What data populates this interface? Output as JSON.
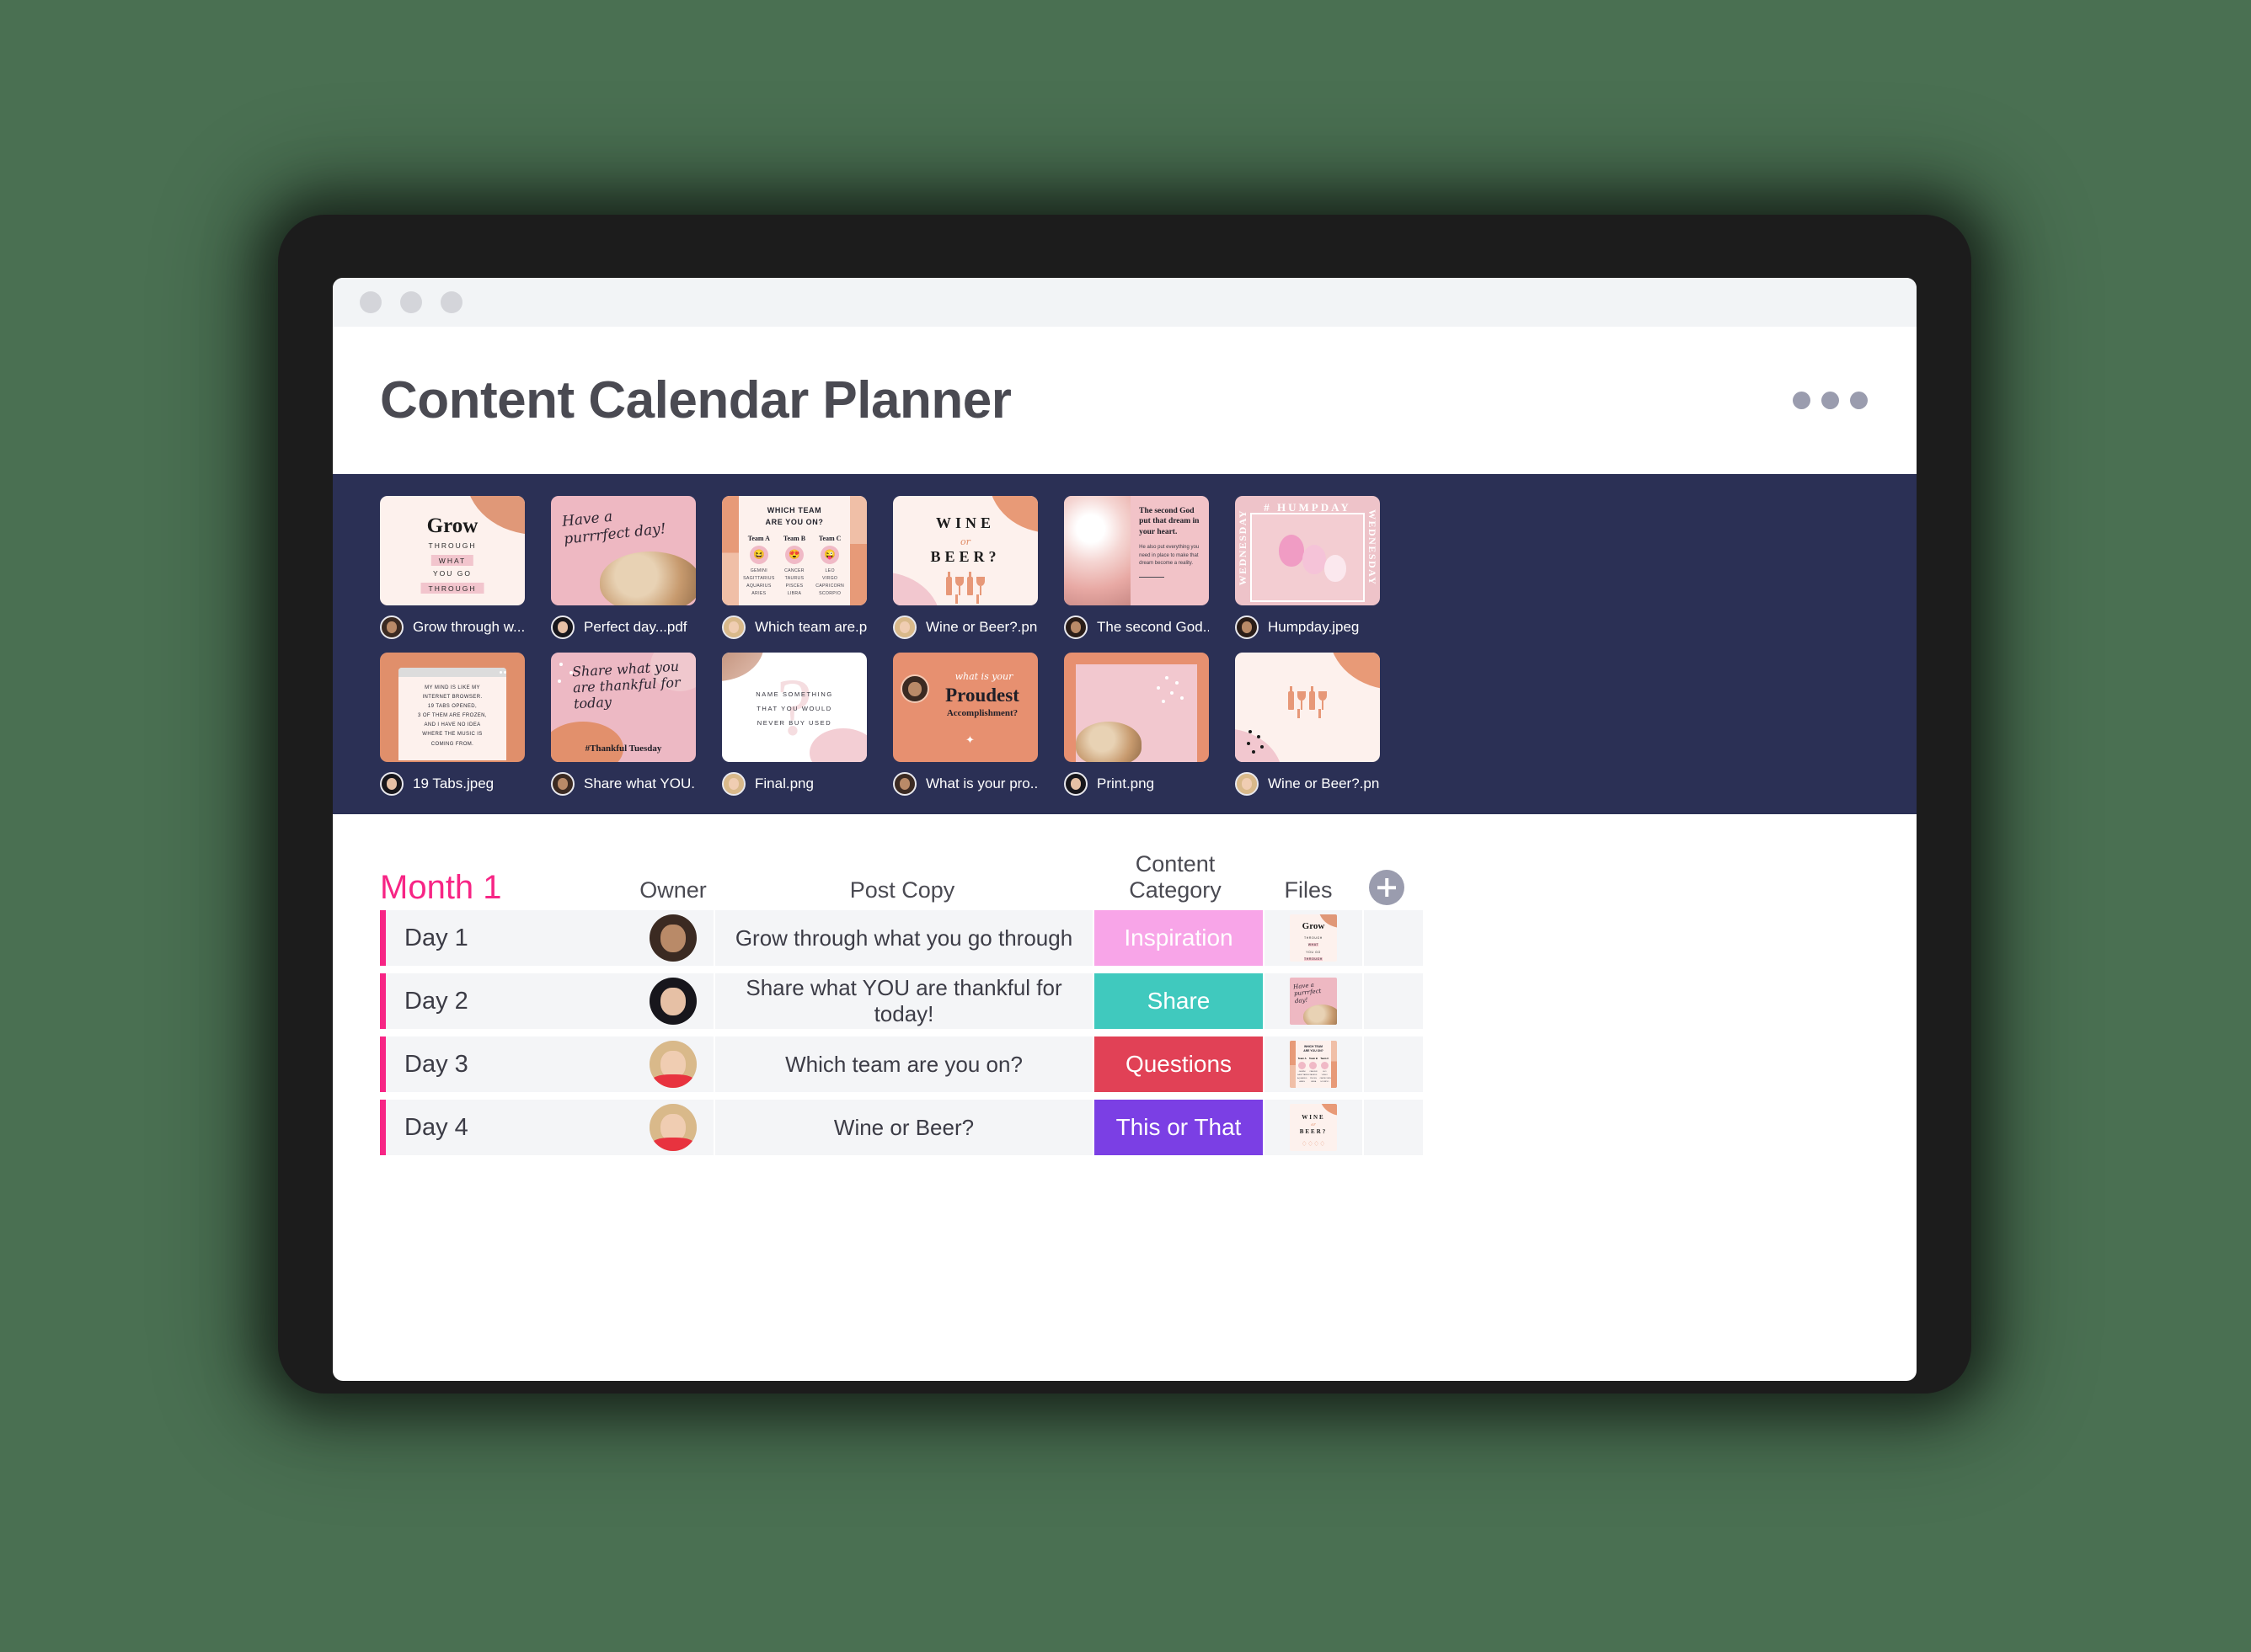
{
  "window": {
    "chrome_dots": 3,
    "title": "Content Calendar Planner",
    "more_menu_label": "more-options"
  },
  "theme": {
    "page_background": "#4a7052",
    "files_panel_background": "#2b3055",
    "accent_pink": "#f72585",
    "title_color": "#4a4a52"
  },
  "files_panel": {
    "rows": [
      [
        {
          "name": "Grow through w...png",
          "art": "grow",
          "art_text": {
            "title": "Grow",
            "l1": "THROUGH",
            "l2": "WHAT",
            "l3": "YOU GO",
            "l4": "THROUGH"
          }
        },
        {
          "name": "Perfect day...pdf",
          "art": "purrfect",
          "art_text": {
            "script": "Have a purrrfect day!"
          }
        },
        {
          "name": "Which team are.png",
          "art": "team",
          "art_text": {
            "heading1": "WHICH TEAM",
            "heading2": "ARE YOU ON?",
            "team_a": "Team A",
            "team_b": "Team B",
            "team_c": "Team C",
            "emoji_a": "😆",
            "emoji_b": "😍",
            "emoji_c": "😜",
            "signs_a": "GEMINI\nSAGITTARIUS\nAQUARIUS\nARIES",
            "signs_b": "CANCER\nTAURUS\nPISCES\nLIBRA",
            "signs_c": "LEO\nVIRGO\nCAPRICORN\nSCORPIO"
          }
        },
        {
          "name": "Wine or Beer?.png",
          "art": "wine",
          "art_text": {
            "l1": "WINE",
            "l2": "or",
            "l3": "BEER?"
          }
        },
        {
          "name": "The second God...pdf",
          "art": "god",
          "art_text": {
            "heading": "The second God put that dream in your heart.",
            "body": "He also put everything you need in place to make that dream become a reality."
          }
        },
        {
          "name": "Humpday.jpeg",
          "art": "humpday",
          "art_text": {
            "top": "# HUMPDAY",
            "left": "WEDNESDAY",
            "right": "WEDNESDAY"
          }
        }
      ],
      [
        {
          "name": "19 Tabs.jpeg",
          "art": "tabs",
          "art_text": {
            "body": "MY MIND IS LIKE MY\nINTERNET BROWSER.\n19 TABS OPENED,\n3 OF THEM ARE FROZEN,\nAND I HAVE NO IDEA\nWHERE THE MUSIC IS\nCOMING FROM."
          }
        },
        {
          "name": "Share what YOU...png",
          "art": "thankful",
          "art_text": {
            "script": "Share what you are thankful for today",
            "tag": "#Thankful Tuesday"
          }
        },
        {
          "name": "Final.png",
          "art": "final",
          "art_text": {
            "l1": "NAME SOMETHING",
            "l2": "THAT YOU WOULD",
            "l3": "NEVER BUY USED"
          }
        },
        {
          "name": "What is your pro...png",
          "art": "proudest",
          "art_text": {
            "l1": "what is your",
            "l2": "Proudest",
            "l3": "Accomplishment?"
          }
        },
        {
          "name": "Print.png",
          "art": "print",
          "art_text": {}
        },
        {
          "name": "Wine or Beer?.png",
          "art": "wine2",
          "art_text": {}
        }
      ]
    ]
  },
  "table": {
    "month_label": "Month 1",
    "headers": {
      "owner": "Owner",
      "post_copy": "Post Copy",
      "content_category": "Content Category",
      "files": "Files",
      "add_column": "+"
    },
    "rows": [
      {
        "day": "Day 1",
        "post_copy": "Grow through what you go through",
        "category": "Inspiration",
        "category_color": "#f8a5e8",
        "file_art": "grow",
        "owner_avatar": "owner-1"
      },
      {
        "day": "Day 2",
        "post_copy": "Share what YOU are thankful for today!",
        "category": "Share",
        "category_color": "#40c9be",
        "file_art": "purrfect",
        "owner_avatar": "owner-2"
      },
      {
        "day": "Day 3",
        "post_copy": "Which team are you on?",
        "category": "Questions",
        "category_color": "#e14156",
        "file_art": "team",
        "owner_avatar": "owner-3"
      },
      {
        "day": "Day 4",
        "post_copy": "Wine or Beer?",
        "category": "This or That",
        "category_color": "#7b3fe4",
        "file_art": "wine",
        "owner_avatar": "owner-4"
      }
    ]
  }
}
